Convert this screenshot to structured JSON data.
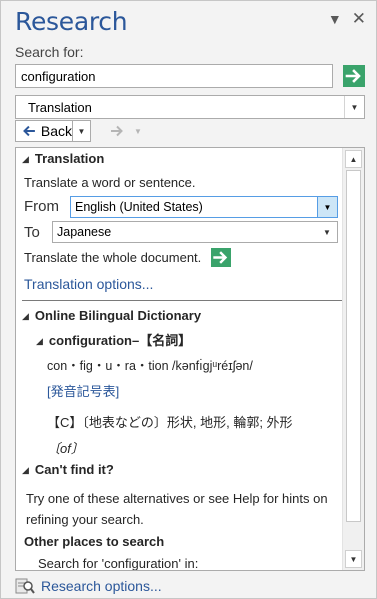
{
  "title": "Research",
  "search": {
    "label": "Search for:",
    "value": "configuration"
  },
  "service": {
    "selected": "Translation"
  },
  "nav": {
    "back_label": "Back"
  },
  "translation": {
    "heading": "Translation",
    "prompt": "Translate a word or sentence.",
    "from_label": "From",
    "from_value": "English (United States)",
    "to_label": "To",
    "to_value": "Japanese",
    "whole_doc": "Translate the whole document.",
    "options_link": "Translation options..."
  },
  "dictionary": {
    "heading": "Online Bilingual Dictionary",
    "entry_head": "configuration–【名詞】",
    "pronunciation": "con・fig・u・ra・tion /kənfı̇gjᵘréɪʃən/",
    "phonetic_link": "[発音記号表]",
    "definition": "【C】〔地表などの〕形状, 地形, 輪郭; 外形",
    "definition_cont": "〔of〕"
  },
  "cant_find": {
    "heading": "Can't find it?",
    "text_line1": "Try one of these alternatives or see Help for hints on",
    "text_line2": "refining your search.",
    "other_places": "Other places to search",
    "search_for": "Search for 'configuration' in:"
  },
  "footer": {
    "options_link": "Research options..."
  },
  "colors": {
    "accent": "#2b579a",
    "go_green": "#3aa36b"
  },
  "icons": [
    "dropdown-icon",
    "close-icon",
    "go-arrow-icon",
    "back-arrow-icon",
    "forward-arrow-icon",
    "collapse-triangle-icon",
    "research-options-icon"
  ]
}
